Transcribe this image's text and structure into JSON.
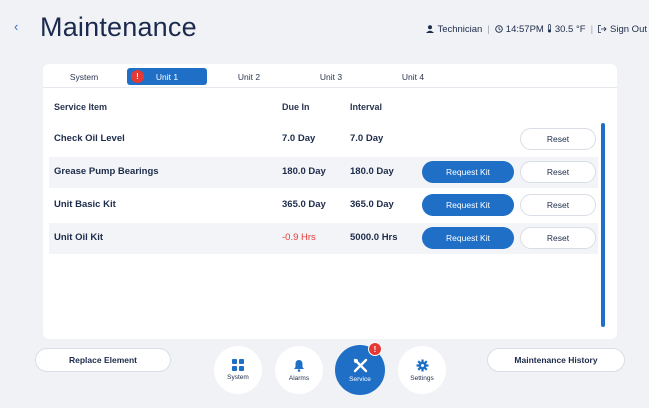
{
  "header": {
    "title": "Maintenance",
    "user_label": "Technician",
    "time": "14:57PM",
    "temperature": "30.5 °F",
    "sign_out_label": "Sign Out"
  },
  "tabs": [
    {
      "label": "System",
      "active": false
    },
    {
      "label": "Unit 1",
      "active": true,
      "badge": "!"
    },
    {
      "label": "Unit 2",
      "active": false
    },
    {
      "label": "Unit 3",
      "active": false
    },
    {
      "label": "Unit 4",
      "active": false
    }
  ],
  "table": {
    "columns": [
      "Service Item",
      "Due In",
      "Interval"
    ],
    "rows": [
      {
        "item": "Check Oil Level",
        "due_in": "7.0 Day",
        "interval": "7.0 Day",
        "request_kit": null,
        "reset": "Reset"
      },
      {
        "item": "Grease Pump Bearings",
        "due_in": "180.0 Day",
        "interval": "180.0 Day",
        "request_kit": "Request Kit",
        "reset": "Reset"
      },
      {
        "item": "Unit Basic Kit",
        "due_in": "365.0 Day",
        "interval": "365.0 Day",
        "request_kit": "Request Kit",
        "reset": "Reset"
      },
      {
        "item": "Unit Oil Kit",
        "due_in": "-0.9 Hrs",
        "interval": "5000.0 Hrs",
        "request_kit": "Request Kit",
        "reset": "Reset"
      }
    ]
  },
  "footer": {
    "replace_element_label": "Replace Element",
    "maintenance_history_label": "Maintenance History",
    "nav": [
      {
        "label": "System",
        "icon": "grid-icon"
      },
      {
        "label": "Alarms",
        "icon": "bell-icon"
      },
      {
        "label": "Service",
        "icon": "wrench-icon",
        "badge": "!"
      },
      {
        "label": "Settings",
        "icon": "gear-icon"
      }
    ]
  },
  "colors": {
    "accent": "#1f6fc7",
    "alert": "#e53935",
    "background": "#f1f2f5"
  }
}
